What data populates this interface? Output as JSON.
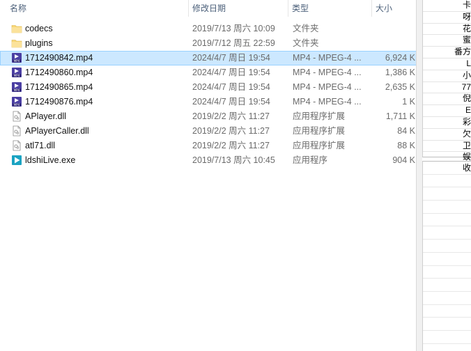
{
  "columns": {
    "name": "名称",
    "date": "修改日期",
    "type": "类型",
    "size": "大小"
  },
  "files": [
    {
      "name": "codecs",
      "date": "2019/7/13 周六 10:09",
      "type": "文件夹",
      "size": "",
      "icon": "folder-icon",
      "selected": false
    },
    {
      "name": "plugins",
      "date": "2019/7/12 周五 22:59",
      "type": "文件夹",
      "size": "",
      "icon": "folder-icon",
      "selected": false
    },
    {
      "name": "1712490842.mp4",
      "date": "2024/4/7 周日 19:54",
      "type": "MP4 - MPEG-4 ...",
      "size": "6,924 K",
      "icon": "mp4-icon",
      "selected": true
    },
    {
      "name": "1712490860.mp4",
      "date": "2024/4/7 周日 19:54",
      "type": "MP4 - MPEG-4 ...",
      "size": "1,386 K",
      "icon": "mp4-icon",
      "selected": false
    },
    {
      "name": "1712490865.mp4",
      "date": "2024/4/7 周日 19:54",
      "type": "MP4 - MPEG-4 ...",
      "size": "2,635 K",
      "icon": "mp4-icon",
      "selected": false
    },
    {
      "name": "1712490876.mp4",
      "date": "2024/4/7 周日 19:54",
      "type": "MP4 - MPEG-4 ...",
      "size": "1 K",
      "icon": "mp4-icon",
      "selected": false
    },
    {
      "name": "APlayer.dll",
      "date": "2019/2/2 周六 11:27",
      "type": "应用程序扩展",
      "size": "1,711 K",
      "icon": "dll-icon",
      "selected": false
    },
    {
      "name": "APlayerCaller.dll",
      "date": "2019/2/2 周六 11:27",
      "type": "应用程序扩展",
      "size": "84 K",
      "icon": "dll-icon",
      "selected": false
    },
    {
      "name": "atl71.dll",
      "date": "2019/2/2 周六 11:27",
      "type": "应用程序扩展",
      "size": "88 K",
      "icon": "dll-icon",
      "selected": false
    },
    {
      "name": "ldshiLive.exe",
      "date": "2019/7/13 周六 10:45",
      "type": "应用程序",
      "size": "904 K",
      "icon": "exe-icon",
      "selected": false
    }
  ],
  "side_panel": {
    "top_items": [
      "卡",
      "呀",
      "花",
      "蜜",
      "番方",
      "L",
      "小",
      "77",
      "倪",
      "E",
      "彩",
      "欠",
      "卫",
      "蜈"
    ],
    "bottom_items": [
      "收"
    ]
  },
  "colors": {
    "selection_bg": "#cce8ff",
    "selection_border": "#99d1ff",
    "folder": "#f8d775",
    "mp4": "#4b3fa3",
    "exe": "#1aa3c2"
  }
}
